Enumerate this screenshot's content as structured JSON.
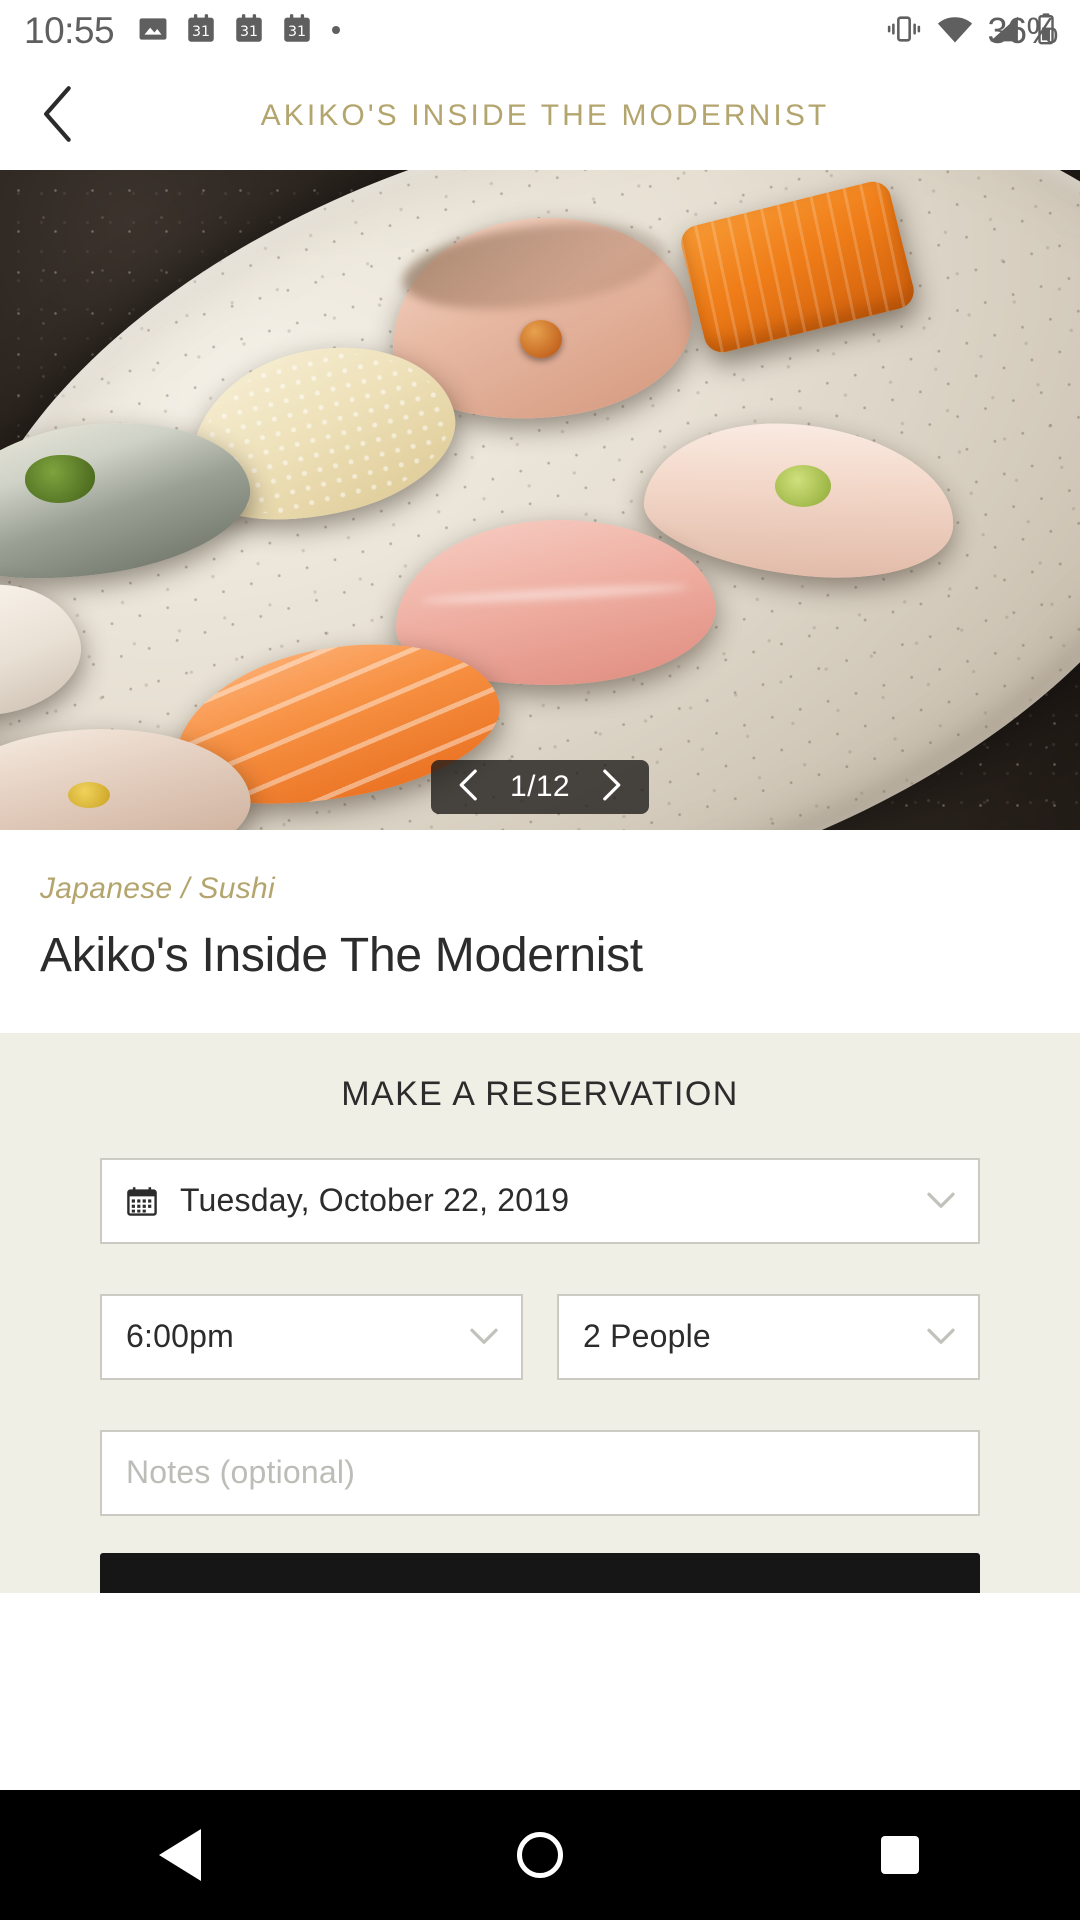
{
  "status_bar": {
    "time": "10:55",
    "battery_text": "36%",
    "left_icons": [
      "image-icon",
      "calendar-31-icon",
      "calendar-31-icon",
      "calendar-31-icon",
      "dot-icon"
    ],
    "right_icons": [
      "vibrate-icon",
      "wifi-icon",
      "cell-signal-icon",
      "battery-icon"
    ]
  },
  "header": {
    "back_icon": "chevron-left-icon",
    "title": "AKIKO'S INSIDE THE MODERNIST",
    "title_color": "#b4a56e"
  },
  "hero": {
    "alt": "plate of assorted nigiri sushi on a long oval ceramic plate",
    "pager": {
      "prev_icon": "chevron-left-icon",
      "next_icon": "chevron-right-icon",
      "count": "1/12",
      "current": 1,
      "total": 12
    }
  },
  "info": {
    "cuisine": "Japanese / Sushi",
    "name": "Akiko's Inside The Modernist"
  },
  "reservation": {
    "title": "MAKE A RESERVATION",
    "background": "#f0efe6",
    "date_field": {
      "icon": "calendar-icon",
      "value": "Tuesday, October 22, 2019",
      "chevron": "chevron-down-icon"
    },
    "time_field": {
      "value": "6:00pm",
      "chevron": "chevron-down-icon"
    },
    "party_field": {
      "value": "2 People",
      "chevron": "chevron-down-icon"
    },
    "notes_field": {
      "value": "",
      "placeholder": "Notes (optional)"
    }
  },
  "nav_bar": {
    "back_label": "Back",
    "home_label": "Home",
    "recents_label": "Recents"
  }
}
